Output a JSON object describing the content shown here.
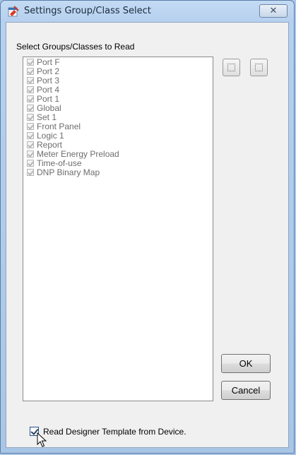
{
  "window": {
    "title": "Settings Group/Class Select",
    "close_glyph": "✕",
    "icon": "settings-app-icon"
  },
  "list": {
    "label": "Select Groups/Classes to Read",
    "items": [
      {
        "label": "Port F",
        "checked": true
      },
      {
        "label": "Port 2",
        "checked": true
      },
      {
        "label": "Port 3",
        "checked": true
      },
      {
        "label": "Port 4",
        "checked": true
      },
      {
        "label": "Port 1",
        "checked": true
      },
      {
        "label": "Global",
        "checked": true
      },
      {
        "label": "Set 1",
        "checked": true
      },
      {
        "label": "Front Panel",
        "checked": true
      },
      {
        "label": "Logic 1",
        "checked": true
      },
      {
        "label": "Report",
        "checked": true
      },
      {
        "label": "Meter Energy Preload",
        "checked": true
      },
      {
        "label": "Time-of-use",
        "checked": true
      },
      {
        "label": "DNP Binary Map",
        "checked": true
      }
    ]
  },
  "buttons": {
    "ok": "OK",
    "cancel": "Cancel",
    "select_all_icon": "select-all-icon",
    "select_none_icon": "select-none-icon"
  },
  "read_template": {
    "label": "Read Designer Template from Device.",
    "checked": true
  },
  "colors": {
    "title_bar": "#b6d0ef",
    "client_bg": "#f0f0f0",
    "disabled_text": "#6d6d6d"
  }
}
